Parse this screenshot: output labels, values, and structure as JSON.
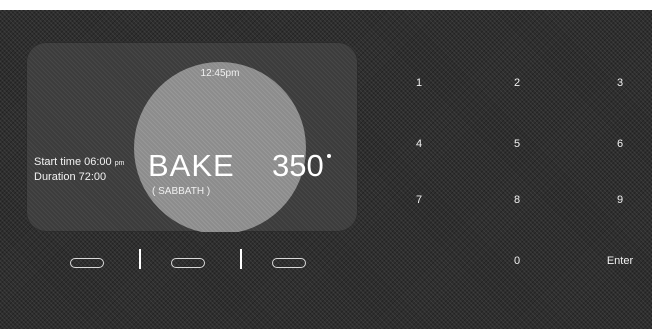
{
  "display": {
    "clock": "12:45pm",
    "start_label": "Start time",
    "start_value": "06:00",
    "start_ampm": "pm",
    "duration_label": "Duration",
    "duration_value": "72:00",
    "mode": "BAKE",
    "submode": "( SABBATH )",
    "temperature": "350"
  },
  "soft_keys": [
    {
      "id": "left"
    },
    {
      "id": "center"
    },
    {
      "id": "right"
    }
  ],
  "keypad": {
    "keys": [
      "1",
      "2",
      "3",
      "4",
      "5",
      "6",
      "7",
      "8",
      "9",
      "0"
    ],
    "enter_label": "Enter"
  },
  "colors": {
    "background": "#2e2e2e",
    "panel": "#3c3c3c",
    "dial": "#8c8c8c",
    "text": "#ffffff"
  }
}
